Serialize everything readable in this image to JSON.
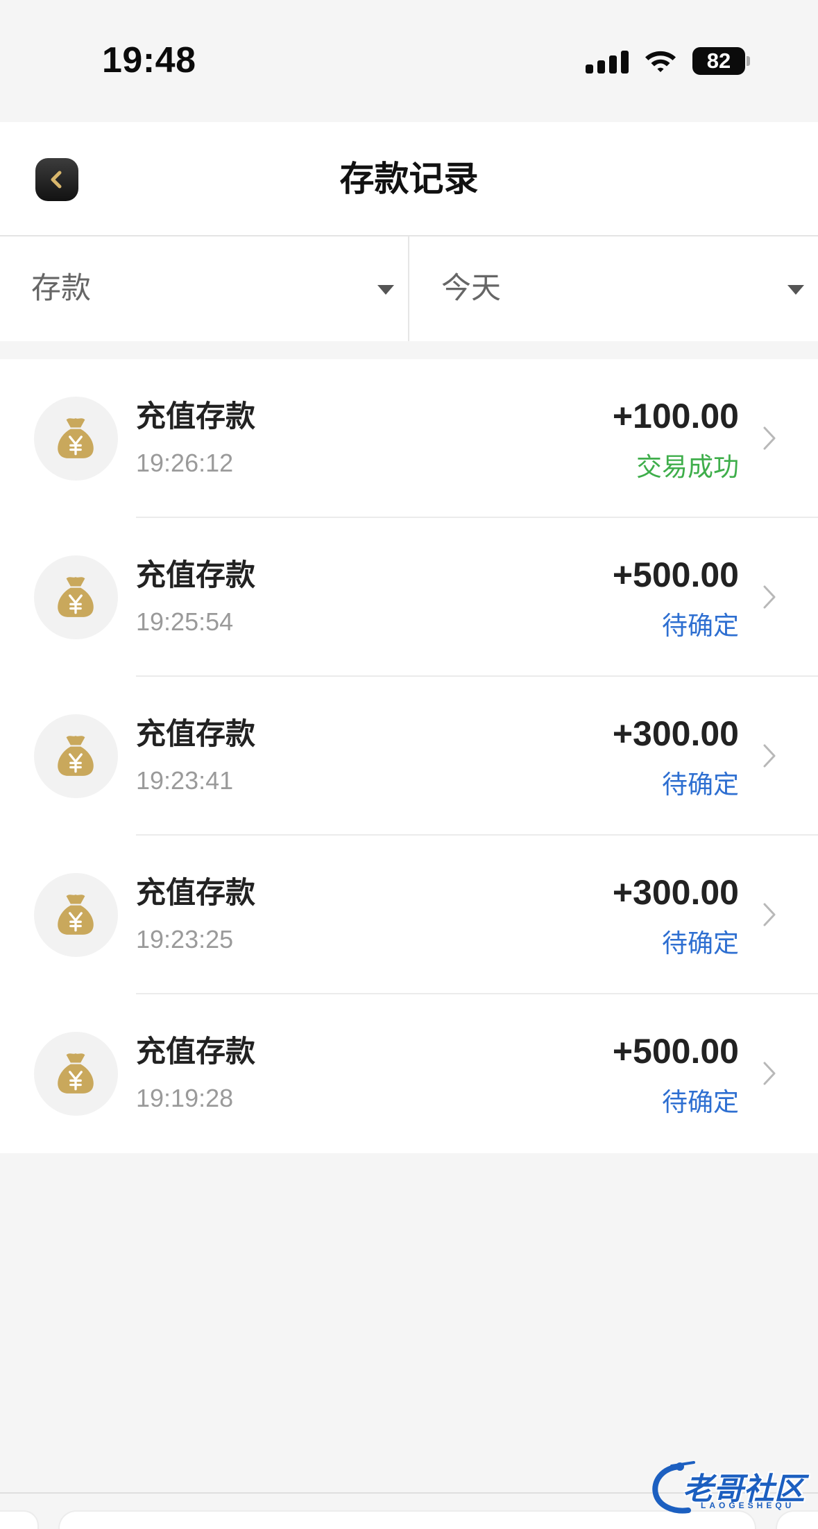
{
  "status_bar": {
    "time": "19:48",
    "battery_level": "82",
    "signal_icon": "cellular-signal-icon",
    "wifi_icon": "wifi-icon",
    "battery_icon": "battery-icon"
  },
  "header": {
    "back_icon": "chevron-left-icon",
    "title": "存款记录"
  },
  "filters": {
    "type": {
      "selected": "存款",
      "icon": "dropdown-arrow-icon"
    },
    "date": {
      "selected": "今天",
      "icon": "dropdown-arrow-icon"
    }
  },
  "records": [
    {
      "icon": "money-bag-icon",
      "title": "充值存款",
      "time": "19:26:12",
      "amount": "+100.00",
      "status": "交易成功",
      "status_color": "#3fae4b",
      "action_icon": "chevron-right-icon"
    },
    {
      "icon": "money-bag-icon",
      "title": "充值存款",
      "time": "19:25:54",
      "amount": "+500.00",
      "status": "待确定",
      "status_color": "#2e6fd1",
      "action_icon": "chevron-right-icon"
    },
    {
      "icon": "money-bag-icon",
      "title": "充值存款",
      "time": "19:23:41",
      "amount": "+300.00",
      "status": "待确定",
      "status_color": "#2e6fd1",
      "action_icon": "chevron-right-icon"
    },
    {
      "icon": "money-bag-icon",
      "title": "充值存款",
      "time": "19:23:25",
      "amount": "+300.00",
      "status": "待确定",
      "status_color": "#2e6fd1",
      "action_icon": "chevron-right-icon"
    },
    {
      "icon": "money-bag-icon",
      "title": "充值存款",
      "time": "19:19:28",
      "amount": "+500.00",
      "status": "待确定",
      "status_color": "#2e6fd1",
      "action_icon": "chevron-right-icon"
    }
  ],
  "colors": {
    "page_background": "#f5f5f5",
    "surface": "#ffffff",
    "gold_accent": "#c9a85c",
    "back_chevron": "#d9b76c",
    "text_primary": "#222222",
    "text_secondary": "#999999",
    "divider": "#ebebeb",
    "status_success": "#3fae4b",
    "status_pending": "#2e6fd1"
  },
  "watermark": {
    "title": "老哥社区",
    "subtitle": "LAOGESHEQU"
  }
}
